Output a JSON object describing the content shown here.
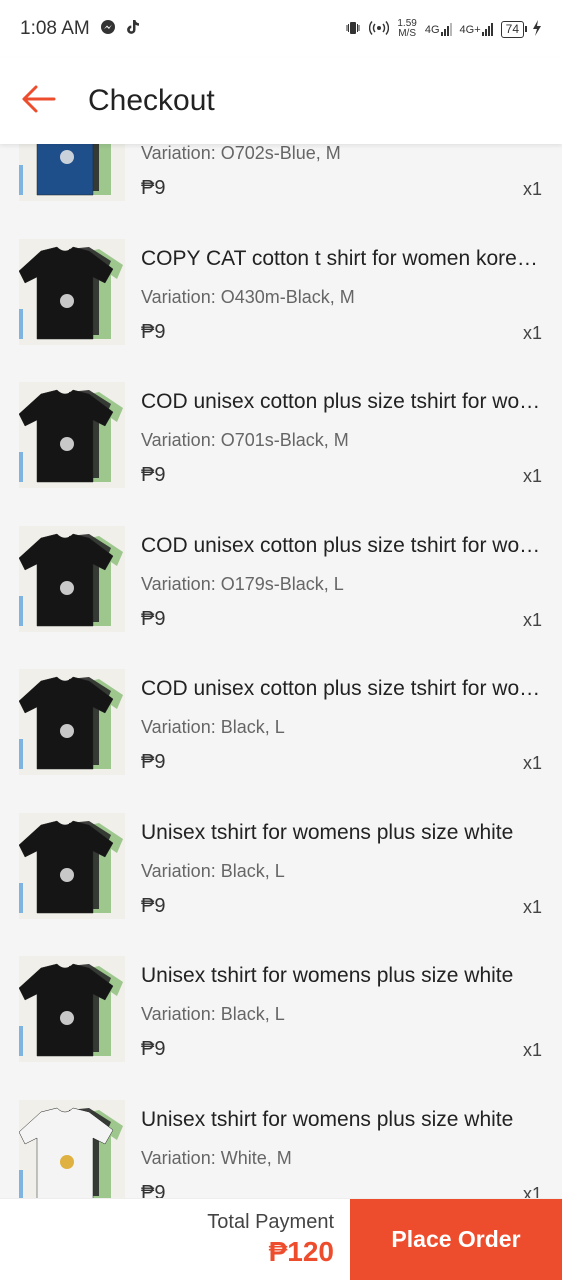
{
  "status_bar": {
    "time": "1:08 AM",
    "speed_value": "1.59",
    "speed_unit": "M/S",
    "network_1": "4G",
    "network_2": "4G+",
    "battery": "74"
  },
  "header": {
    "title": "Checkout",
    "back_icon": "arrow-left-icon"
  },
  "colors": {
    "accent": "#ee4d2d",
    "background": "#f5f5f5"
  },
  "items": [
    {
      "name": "",
      "variation": "Variation: O702s-Blue, M",
      "price": "₱9",
      "qty": "x1",
      "shirt_color": "#1f4f8a"
    },
    {
      "name": "COPY CAT cotton t shirt for women korean style",
      "variation": "Variation: O430m-Black, M",
      "price": "₱9",
      "qty": "x1",
      "shirt_color": "#151515"
    },
    {
      "name": "COD unisex cotton plus size tshirt for women",
      "variation": "Variation: O701s-Black, M",
      "price": "₱9",
      "qty": "x1",
      "shirt_color": "#151515"
    },
    {
      "name": "COD unisex cotton plus size tshirt for women",
      "variation": "Variation: O179s-Black, L",
      "price": "₱9",
      "qty": "x1",
      "shirt_color": "#151515"
    },
    {
      "name": "COD unisex cotton plus size tshirt for women",
      "variation": "Variation: Black, L",
      "price": "₱9",
      "qty": "x1",
      "shirt_color": "#151515"
    },
    {
      "name": "Unisex tshirt for womens plus size white",
      "variation": "Variation: Black, L",
      "price": "₱9",
      "qty": "x1",
      "shirt_color": "#151515"
    },
    {
      "name": "Unisex tshirt for womens plus size white",
      "variation": "Variation: Black, L",
      "price": "₱9",
      "qty": "x1",
      "shirt_color": "#151515"
    },
    {
      "name": "Unisex tshirt for womens plus size white",
      "variation": "Variation: White, M",
      "price": "₱9",
      "qty": "x1",
      "shirt_color": "#f4f4f4"
    }
  ],
  "footer": {
    "total_label": "Total Payment",
    "total_value": "₱120",
    "place_order_label": "Place Order"
  }
}
